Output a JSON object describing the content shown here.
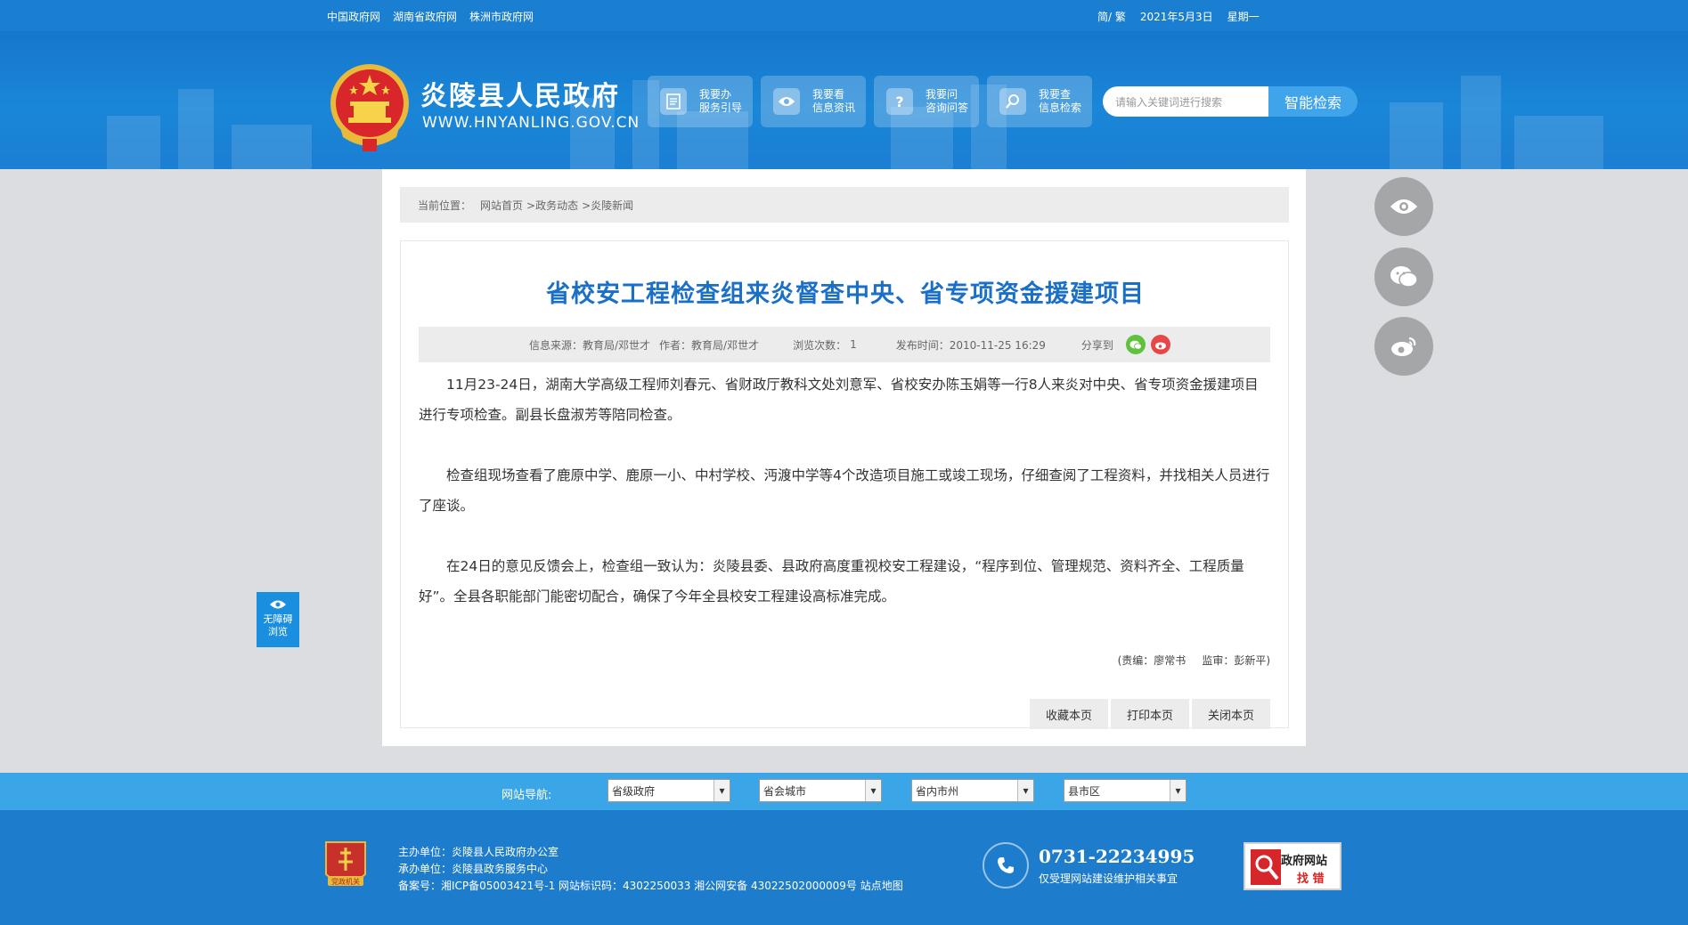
{
  "topbar": {
    "links": [
      "中国政府网",
      "湖南省政府网",
      "株洲市政府网"
    ],
    "lang": "简/ 繁",
    "date": "2021年5月3日",
    "weekday": "星期一"
  },
  "header": {
    "site_name": "炎陵县人民政府",
    "site_url": "WWW.HNYANLING.GOV.CN",
    "nav_buttons": [
      {
        "line1": "我要办",
        "line2": "服务引导",
        "icon": "document-icon"
      },
      {
        "line1": "我要看",
        "line2": "信息资讯",
        "icon": "eye-icon"
      },
      {
        "line1": "我要问",
        "line2": "咨询问答",
        "icon": "question-icon"
      },
      {
        "line1": "我要查",
        "line2": "信息检索",
        "icon": "magnifier-icon"
      }
    ],
    "search_placeholder": "请输入关键词进行搜索",
    "search_button": "智能检索"
  },
  "breadcrumb": {
    "label": "当前位置：",
    "items": [
      "网站首页",
      ">政务动态",
      ">炎陵新闻"
    ]
  },
  "article": {
    "title": "省校安工程检查组来炎督查中央、省专项资金援建项目",
    "meta": {
      "source": "信息来源：教育局/邓世才",
      "author": "作者：教育局/邓世才",
      "views": "浏览次数：",
      "views_count": "1",
      "published": "发布时间：2010-11-25 16:29",
      "share": "分享到"
    },
    "paragraphs": [
      "11月23-24日，湖南大学高级工程师刘春元、省财政厅教科文处刘意军、省校安办陈玉娟等一行8人来炎对中央、省专项资金援建项目进行专项检查。副县长盘淑芳等陪同检查。",
      "检查组现场查看了鹿原中学、鹿原一小、中村学校、沔渡中学等4个改造项目施工或竣工现场，仔细查阅了工程资料，并找相关人员进行了座谈。",
      "在24日的意见反馈会上，检查组一致认为：炎陵县委、县政府高度重视校安工程建设，“程序到位、管理规范、资料齐全、工程质量好”。全县各职能部门能密切配合，确保了今年全县校安工程建设高标准完成。"
    ],
    "editor": "(责编：廖常书",
    "supervisor": "监审：彭新平)",
    "tools": [
      "收藏本页",
      "打印本页",
      "关闭本页"
    ]
  },
  "accessibility": {
    "line1": "无障碍",
    "line2": "浏览"
  },
  "site_nav": {
    "label": "网站导航:",
    "selects": [
      "省级政府",
      "省会城市",
      "省内市州",
      "县市区"
    ]
  },
  "footer": {
    "host": "主办单位：炎陵县人民政府办公室",
    "organizer": "承办单位：炎陵县政务服务中心",
    "record": "备案号：湘ICP备05003421号-1  网站标识码：4302250033  湘公网安备 43022502000009号  站点地图",
    "badge_text": "党政机关",
    "phone": "0731-22234995",
    "phone_note": "仅受理网站建设维护相关事宜",
    "error_box": {
      "line1": "政府网站",
      "line2": "找 错"
    }
  },
  "colors": {
    "primary_blue": "#1a7fd0",
    "title_blue": "#1a6fc9",
    "nav_bar": "#3aa6e7",
    "footer": "#1d7ccc"
  }
}
